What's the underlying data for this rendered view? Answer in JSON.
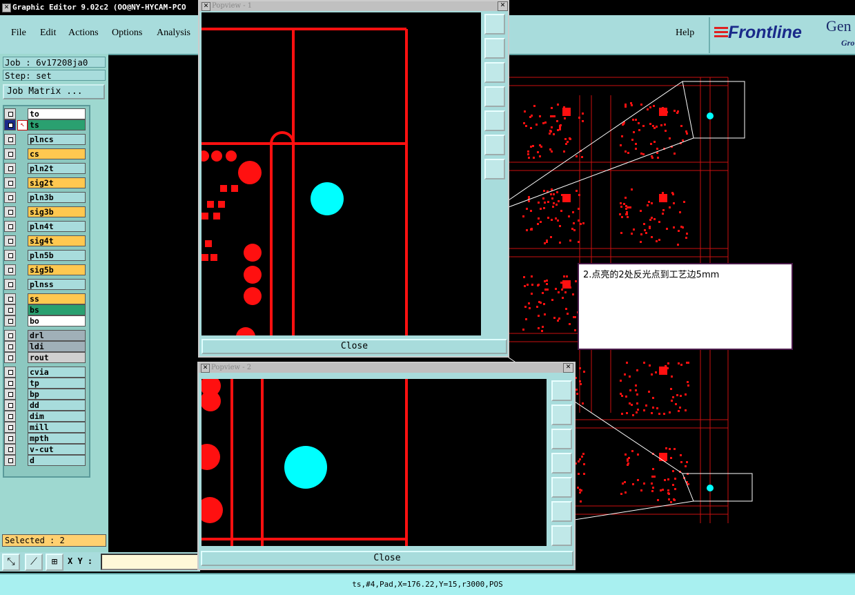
{
  "window": {
    "title": "Graphic Editor 9.02c2  (OO@NY-HYCAM-PCO"
  },
  "menu": {
    "file": "File",
    "edit": "Edit",
    "actions": "Actions",
    "options": "Options",
    "analysis": "Analysis",
    "help": "Help"
  },
  "logo": {
    "brand": "Frontline",
    "partial_1": "Gen",
    "partial_2": "Gro"
  },
  "job": {
    "job_label": "Job : 6v17208ja0",
    "step_label": "Step: set",
    "matrix_button": "Job Matrix ..."
  },
  "layers": [
    {
      "name": "to",
      "color": "#ffffff"
    },
    {
      "name": "ts",
      "color": "#2aa070",
      "active": true
    },
    {
      "name": "plncs",
      "color": "#a8dcdc"
    },
    {
      "name": "cs",
      "color": "#ffc850"
    },
    {
      "name": "pln2t",
      "color": "#a8dcdc"
    },
    {
      "name": "sig2t",
      "color": "#ffc850"
    },
    {
      "name": "pln3b",
      "color": "#a8dcdc"
    },
    {
      "name": "sig3b",
      "color": "#ffc850"
    },
    {
      "name": "pln4t",
      "color": "#a8dcdc"
    },
    {
      "name": "sig4t",
      "color": "#ffc850"
    },
    {
      "name": "pln5b",
      "color": "#a8dcdc"
    },
    {
      "name": "sig5b",
      "color": "#ffc850"
    },
    {
      "name": "plnss",
      "color": "#a8dcdc"
    },
    {
      "name": "ss",
      "color": "#ffc850"
    },
    {
      "name": "bs",
      "color": "#2aa070"
    },
    {
      "name": "bo",
      "color": "#ffffff"
    },
    {
      "name": "drl",
      "color": "#a0b0b8"
    },
    {
      "name": "ldi",
      "color": "#a0b0b8"
    },
    {
      "name": "rout",
      "color": "#d0d0d0"
    },
    {
      "name": "cvia",
      "color": "#a8dcdc"
    },
    {
      "name": "tp",
      "color": "#a8dcdc"
    },
    {
      "name": "bp",
      "color": "#a8dcdc"
    },
    {
      "name": "dd",
      "color": "#a8dcdc"
    },
    {
      "name": "dim",
      "color": "#a8dcdc"
    },
    {
      "name": "mill",
      "color": "#a8dcdc"
    },
    {
      "name": "mpth",
      "color": "#a8dcdc"
    },
    {
      "name": "v-cut",
      "color": "#a8dcdc"
    },
    {
      "name": "d",
      "color": "#a8dcdc"
    }
  ],
  "selected": "Selected : 2",
  "xy_label": "X Y :",
  "status": "ts,#4,Pad,X=176.22,Y=15,r3000,POS",
  "popview1": {
    "title": "Popview - 1",
    "close": "Close"
  },
  "popview2": {
    "title": "Popview - 2",
    "close": "Close"
  },
  "note": "2.点亮的2处反光点到工艺边5mm",
  "colors": {
    "pad": "#ff1010",
    "highlight": "#00ffff",
    "panel": "#a8dcdc"
  }
}
